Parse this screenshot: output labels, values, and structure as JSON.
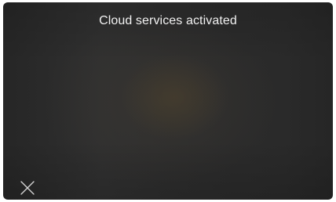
{
  "notification": {
    "message": "Cloud services activated"
  },
  "controls": {
    "close_icon": "close-icon"
  },
  "colors": {
    "background": "#2b2b2b",
    "text": "#f2f2f2",
    "icon": "#d8d8d8"
  }
}
